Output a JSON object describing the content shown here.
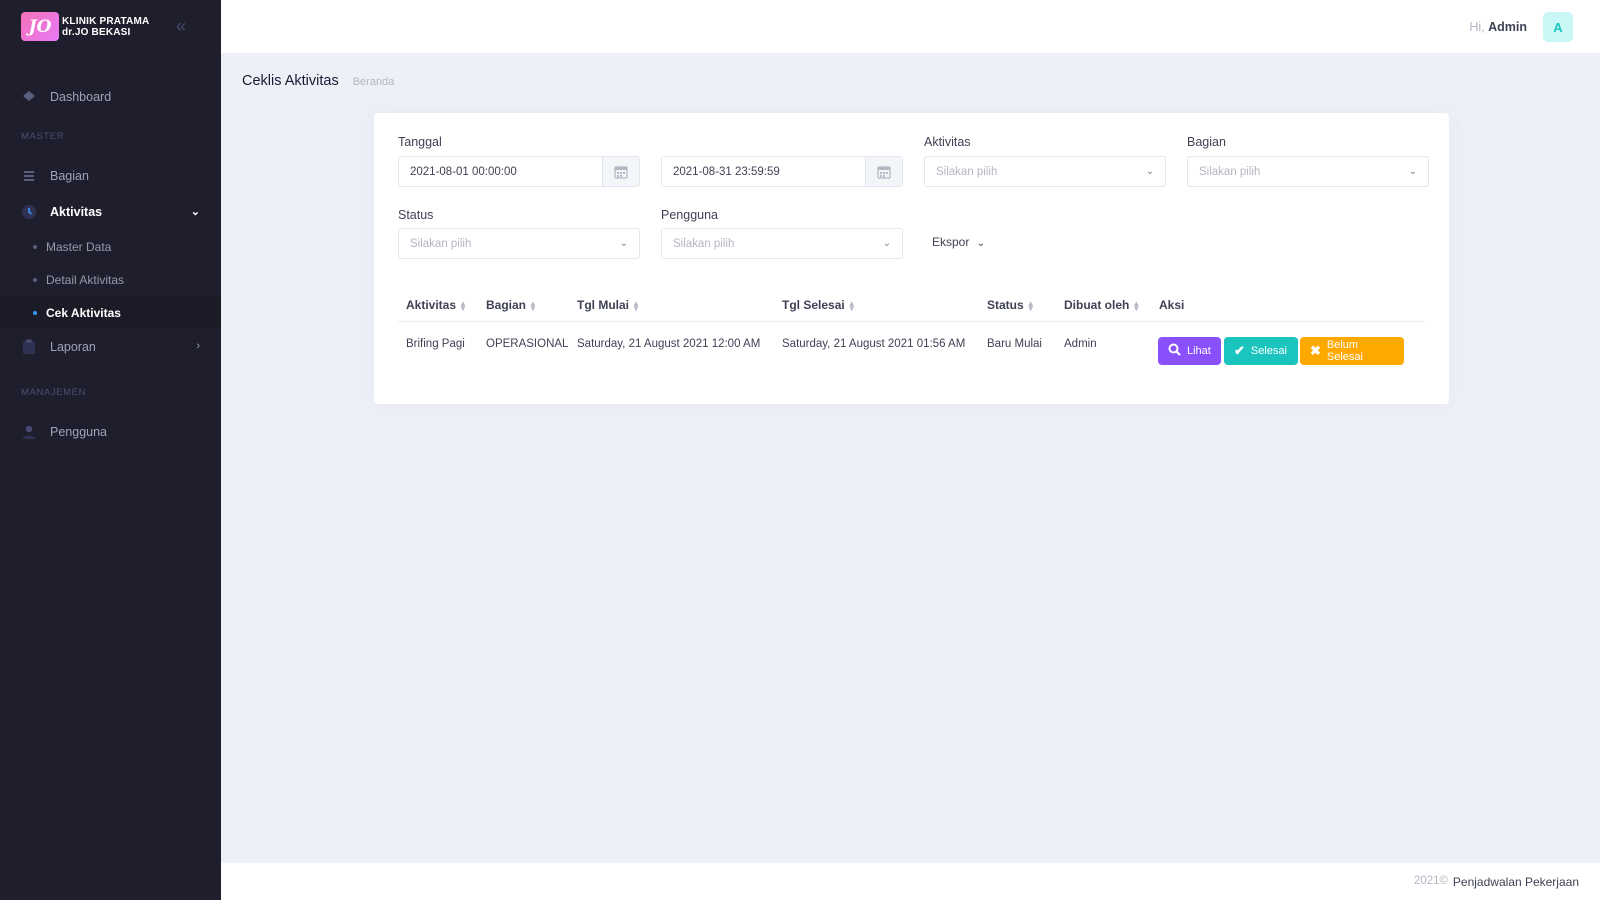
{
  "brand": {
    "logo_text": "JO",
    "line1": "KLINIK PRATAMA",
    "line2": "dr.JO BEKASI"
  },
  "sidebar": {
    "dashboard": "Dashboard",
    "section_master": "MASTER",
    "bagian": "Bagian",
    "aktivitas": "Aktivitas",
    "sub": [
      "Master Data",
      "Detail Aktivitas",
      "Cek Aktivitas"
    ],
    "laporan": "Laporan",
    "section_manajemen": "MANAJEMEN",
    "pengguna": "Pengguna"
  },
  "header": {
    "greeting": "Hi,",
    "user": "Admin",
    "avatar_letter": "A"
  },
  "subheader": {
    "title": "Ceklis Aktivitas",
    "breadcrumb": "Beranda"
  },
  "filters": {
    "tanggal_label": "Tanggal",
    "date_from": "2021-08-01 00:00:00",
    "date_to": "2021-08-31 23:59:59",
    "aktivitas_label": "Aktivitas",
    "aktivitas_placeholder": "Silakan pilih",
    "bagian_label": "Bagian",
    "bagian_placeholder": "Silakan pilih",
    "status_label": "Status",
    "status_placeholder": "Silakan pilih",
    "pengguna_label": "Pengguna",
    "pengguna_placeholder": "Silakan pilih",
    "export_label": "Ekspor"
  },
  "table": {
    "columns": [
      "Aktivitas",
      "Bagian",
      "Tgl Mulai",
      "Tgl Selesai",
      "Status",
      "Dibuat oleh",
      "Aksi"
    ],
    "rows": [
      [
        "Brifing Pagi",
        "OPERASIONAL",
        "Saturday, 21 August 2021 12:00 AM",
        "Saturday, 21 August 2021 01:56 AM",
        "Baru Mulai",
        "Admin"
      ]
    ],
    "actions": {
      "view": "Lihat",
      "done": "Selesai",
      "undone": "Belum Selesai"
    }
  },
  "footer": {
    "year": "2021©",
    "app": "Penjadwalan Pekerjaan"
  },
  "colors": {
    "sidebar_bg": "#1e1e2d",
    "primary": "#3699ff",
    "view": "#8950fc",
    "done": "#1bc5bd",
    "undone": "#ffa800"
  }
}
